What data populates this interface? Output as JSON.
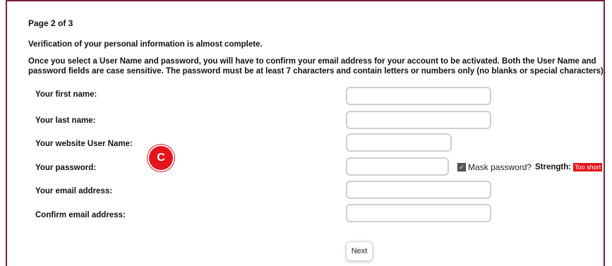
{
  "page_indicator": "Page 2 of 3",
  "verify_text": "Verification of your personal information is almost complete.",
  "info_text": "Once you select a User Name and password, you will have to confirm your email address for your account to be activated. Both the User Name and password fields are case sensitive. The password must be at least 7 characters and contain letters or numbers only (no blanks or special characters).",
  "form": {
    "first_name_label": "Your first name:",
    "last_name_label": "Your last name:",
    "username_label": "Your website User Name:",
    "password_label": "Your password:",
    "email_label": "Your email address:",
    "confirm_email_label": "Confirm email address:",
    "first_name_value": "",
    "last_name_value": "",
    "username_value": "",
    "password_value": "",
    "email_value": "",
    "confirm_email_value": ""
  },
  "mask_password_label": "Mask password?",
  "mask_password_checked": true,
  "strength_label": "Strength:",
  "strength_value": "Too short",
  "marker_label": "C",
  "next_button_label": "Next",
  "colors": {
    "accent_border": "#7a1f3d",
    "strength_badge": "#e3141c",
    "marker": "#e3141c"
  }
}
